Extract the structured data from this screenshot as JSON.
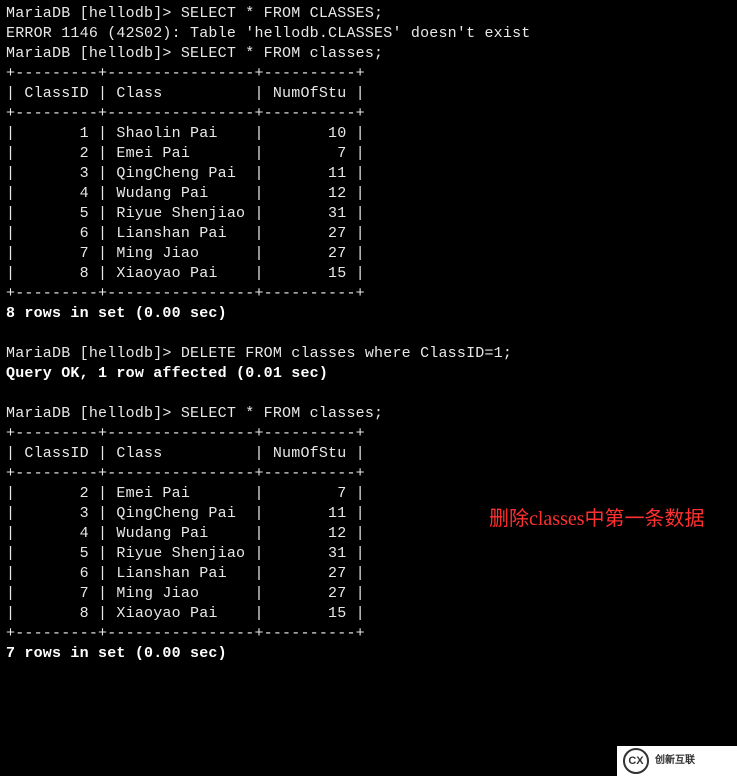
{
  "prompt": "MariaDB [hellodb]> ",
  "cmd1": "SELECT * FROM CLASSES;",
  "error_line": "ERROR 1146 (42S02): Table 'hellodb.CLASSES' doesn't exist",
  "cmd2": "SELECT * FROM classes;",
  "table_sep": "+---------+----------------+----------+",
  "table_header": "| ClassID | Class          | NumOfStu |",
  "table1_rows": [
    "|       1 | Shaolin Pai    |       10 |",
    "|       2 | Emei Pai       |        7 |",
    "|       3 | QingCheng Pai  |       11 |",
    "|       4 | Wudang Pai     |       12 |",
    "|       5 | Riyue Shenjiao |       31 |",
    "|       6 | Lianshan Pai   |       27 |",
    "|       7 | Ming Jiao      |       27 |",
    "|       8 | Xiaoyao Pai    |       15 |"
  ],
  "result1": "8 rows in set (0.00 sec)",
  "cmd3": "DELETE FROM classes where ClassID=1;",
  "result2": "Query OK, 1 row affected (0.01 sec)",
  "cmd4": "SELECT * FROM classes;",
  "table2_rows": [
    "|       2 | Emei Pai       |        7 |",
    "|       3 | QingCheng Pai  |       11 |",
    "|       4 | Wudang Pai     |       12 |",
    "|       5 | Riyue Shenjiao |       31 |",
    "|       6 | Lianshan Pai   |       27 |",
    "|       7 | Ming Jiao      |       27 |",
    "|       8 | Xiaoyao Pai    |       15 |"
  ],
  "result3": "7 rows in set (0.00 sec)",
  "annotation": "删除classes中第一条数据",
  "watermark": {
    "logo": "CX",
    "text": "创新互联"
  },
  "chart_data": {
    "type": "table",
    "title": "classes table",
    "columns": [
      "ClassID",
      "Class",
      "NumOfStu"
    ],
    "before_delete": [
      {
        "ClassID": 1,
        "Class": "Shaolin Pai",
        "NumOfStu": 10
      },
      {
        "ClassID": 2,
        "Class": "Emei Pai",
        "NumOfStu": 7
      },
      {
        "ClassID": 3,
        "Class": "QingCheng Pai",
        "NumOfStu": 11
      },
      {
        "ClassID": 4,
        "Class": "Wudang Pai",
        "NumOfStu": 12
      },
      {
        "ClassID": 5,
        "Class": "Riyue Shenjiao",
        "NumOfStu": 31
      },
      {
        "ClassID": 6,
        "Class": "Lianshan Pai",
        "NumOfStu": 27
      },
      {
        "ClassID": 7,
        "Class": "Ming Jiao",
        "NumOfStu": 27
      },
      {
        "ClassID": 8,
        "Class": "Xiaoyao Pai",
        "NumOfStu": 15
      }
    ],
    "after_delete": [
      {
        "ClassID": 2,
        "Class": "Emei Pai",
        "NumOfStu": 7
      },
      {
        "ClassID": 3,
        "Class": "QingCheng Pai",
        "NumOfStu": 11
      },
      {
        "ClassID": 4,
        "Class": "Wudang Pai",
        "NumOfStu": 12
      },
      {
        "ClassID": 5,
        "Class": "Riyue Shenjiao",
        "NumOfStu": 31
      },
      {
        "ClassID": 6,
        "Class": "Lianshan Pai",
        "NumOfStu": 27
      },
      {
        "ClassID": 7,
        "Class": "Ming Jiao",
        "NumOfStu": 27
      },
      {
        "ClassID": 8,
        "Class": "Xiaoyao Pai",
        "NumOfStu": 15
      }
    ]
  }
}
